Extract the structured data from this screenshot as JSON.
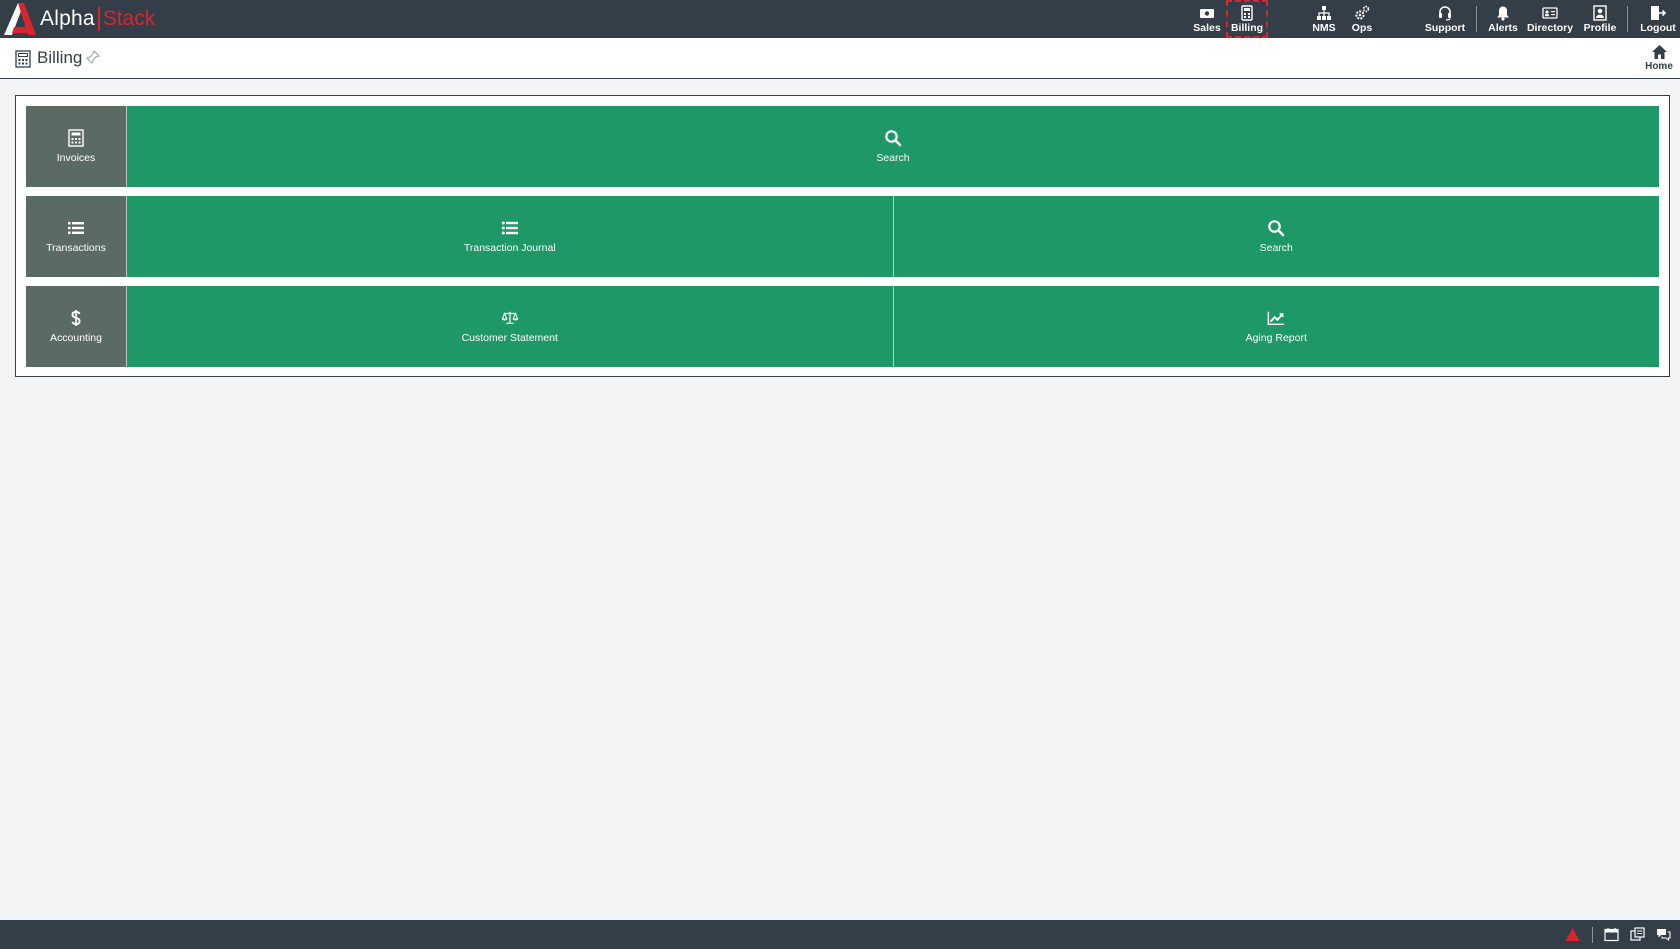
{
  "brand": {
    "alpha": "Alpha",
    "stack": "Stack",
    "accent_color": "#d7262f"
  },
  "nav": {
    "items": [
      {
        "label": "Sales",
        "icon": "cash-icon"
      },
      {
        "label": "Billing",
        "icon": "calculator-icon",
        "active": true
      },
      {
        "label": "NMS",
        "icon": "network-icon"
      },
      {
        "label": "Ops",
        "icon": "gears-icon"
      },
      {
        "label": "Support",
        "icon": "headset-icon"
      },
      {
        "label": "Alerts",
        "icon": "bell-icon"
      },
      {
        "label": "Directory",
        "icon": "id-card-icon"
      },
      {
        "label": "Profile",
        "icon": "user-square-icon"
      },
      {
        "label": "Logout",
        "icon": "logout-icon"
      }
    ]
  },
  "header": {
    "title": "Billing",
    "home_label": "Home"
  },
  "sections": [
    {
      "label": "Invoices",
      "icon": "calculator-icon",
      "tiles": [
        {
          "label": "Search",
          "icon": "search-icon"
        }
      ]
    },
    {
      "label": "Transactions",
      "icon": "list-icon",
      "tiles": [
        {
          "label": "Transaction Journal",
          "icon": "list-icon"
        },
        {
          "label": "Search",
          "icon": "search-icon"
        }
      ]
    },
    {
      "label": "Accounting",
      "icon": "dollar-icon",
      "tiles": [
        {
          "label": "Customer Statement",
          "icon": "balance-scale-icon"
        },
        {
          "label": "Aging Report",
          "icon": "line-chart-icon"
        }
      ]
    }
  ],
  "colors": {
    "nav_bg": "#333e48",
    "tile_green": "#1d9866",
    "section_head": "#5a6b63",
    "page_bg": "#f3f4f6"
  },
  "footer_icons": [
    "warning-icon",
    "calendar-icon",
    "windows-icon",
    "chat-icon"
  ]
}
